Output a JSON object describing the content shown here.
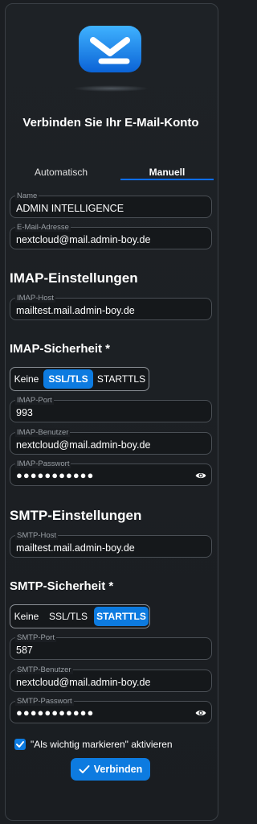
{
  "title": "Verbinden Sie Ihr E-Mail-Konto",
  "tabs": {
    "automatic": "Automatisch",
    "manual": "Manuell",
    "active": "manual"
  },
  "name": {
    "label": "Name",
    "value": "ADMIN INTELLIGENCE"
  },
  "email": {
    "label": "E-Mail-Adresse",
    "value": "nextcloud@mail.admin-boy.de"
  },
  "imap": {
    "heading": "IMAP-Einstellungen",
    "host": {
      "label": "IMAP-Host",
      "value": "mailtest.mail.admin-boy.de"
    },
    "security_heading": "IMAP-Sicherheit *",
    "security_options": [
      "Keine",
      "SSL/TLS",
      "STARTTLS"
    ],
    "security_selected": "SSL/TLS",
    "port": {
      "label": "IMAP-Port",
      "value": "993"
    },
    "user": {
      "label": "IMAP-Benutzer",
      "value": "nextcloud@mail.admin-boy.de"
    },
    "password": {
      "label": "IMAP-Passwort",
      "value": "●●●●●●●●●●●"
    }
  },
  "smtp": {
    "heading": "SMTP-Einstellungen",
    "host": {
      "label": "SMTP-Host",
      "value": "mailtest.mail.admin-boy.de"
    },
    "security_heading": "SMTP-Sicherheit *",
    "security_options": [
      "Keine",
      "SSL/TLS",
      "STARTTLS"
    ],
    "security_selected": "STARTTLS",
    "port": {
      "label": "SMTP-Port",
      "value": "587"
    },
    "user": {
      "label": "SMTP-Benutzer",
      "value": "nextcloud@mail.admin-boy.de"
    },
    "password": {
      "label": "SMTP-Passwort",
      "value": "●●●●●●●●●●●"
    }
  },
  "important": {
    "label": "\"Als wichtig markieren\" aktivieren",
    "checked": true
  },
  "connect_button": "Verbinden",
  "colors": {
    "accent": "#0d7be0",
    "background": "#1b1e22",
    "logo": "#1e90ff"
  },
  "icons": {
    "logo": "mail-envelope-icon",
    "eye": "eye-icon",
    "check": "check-icon"
  }
}
